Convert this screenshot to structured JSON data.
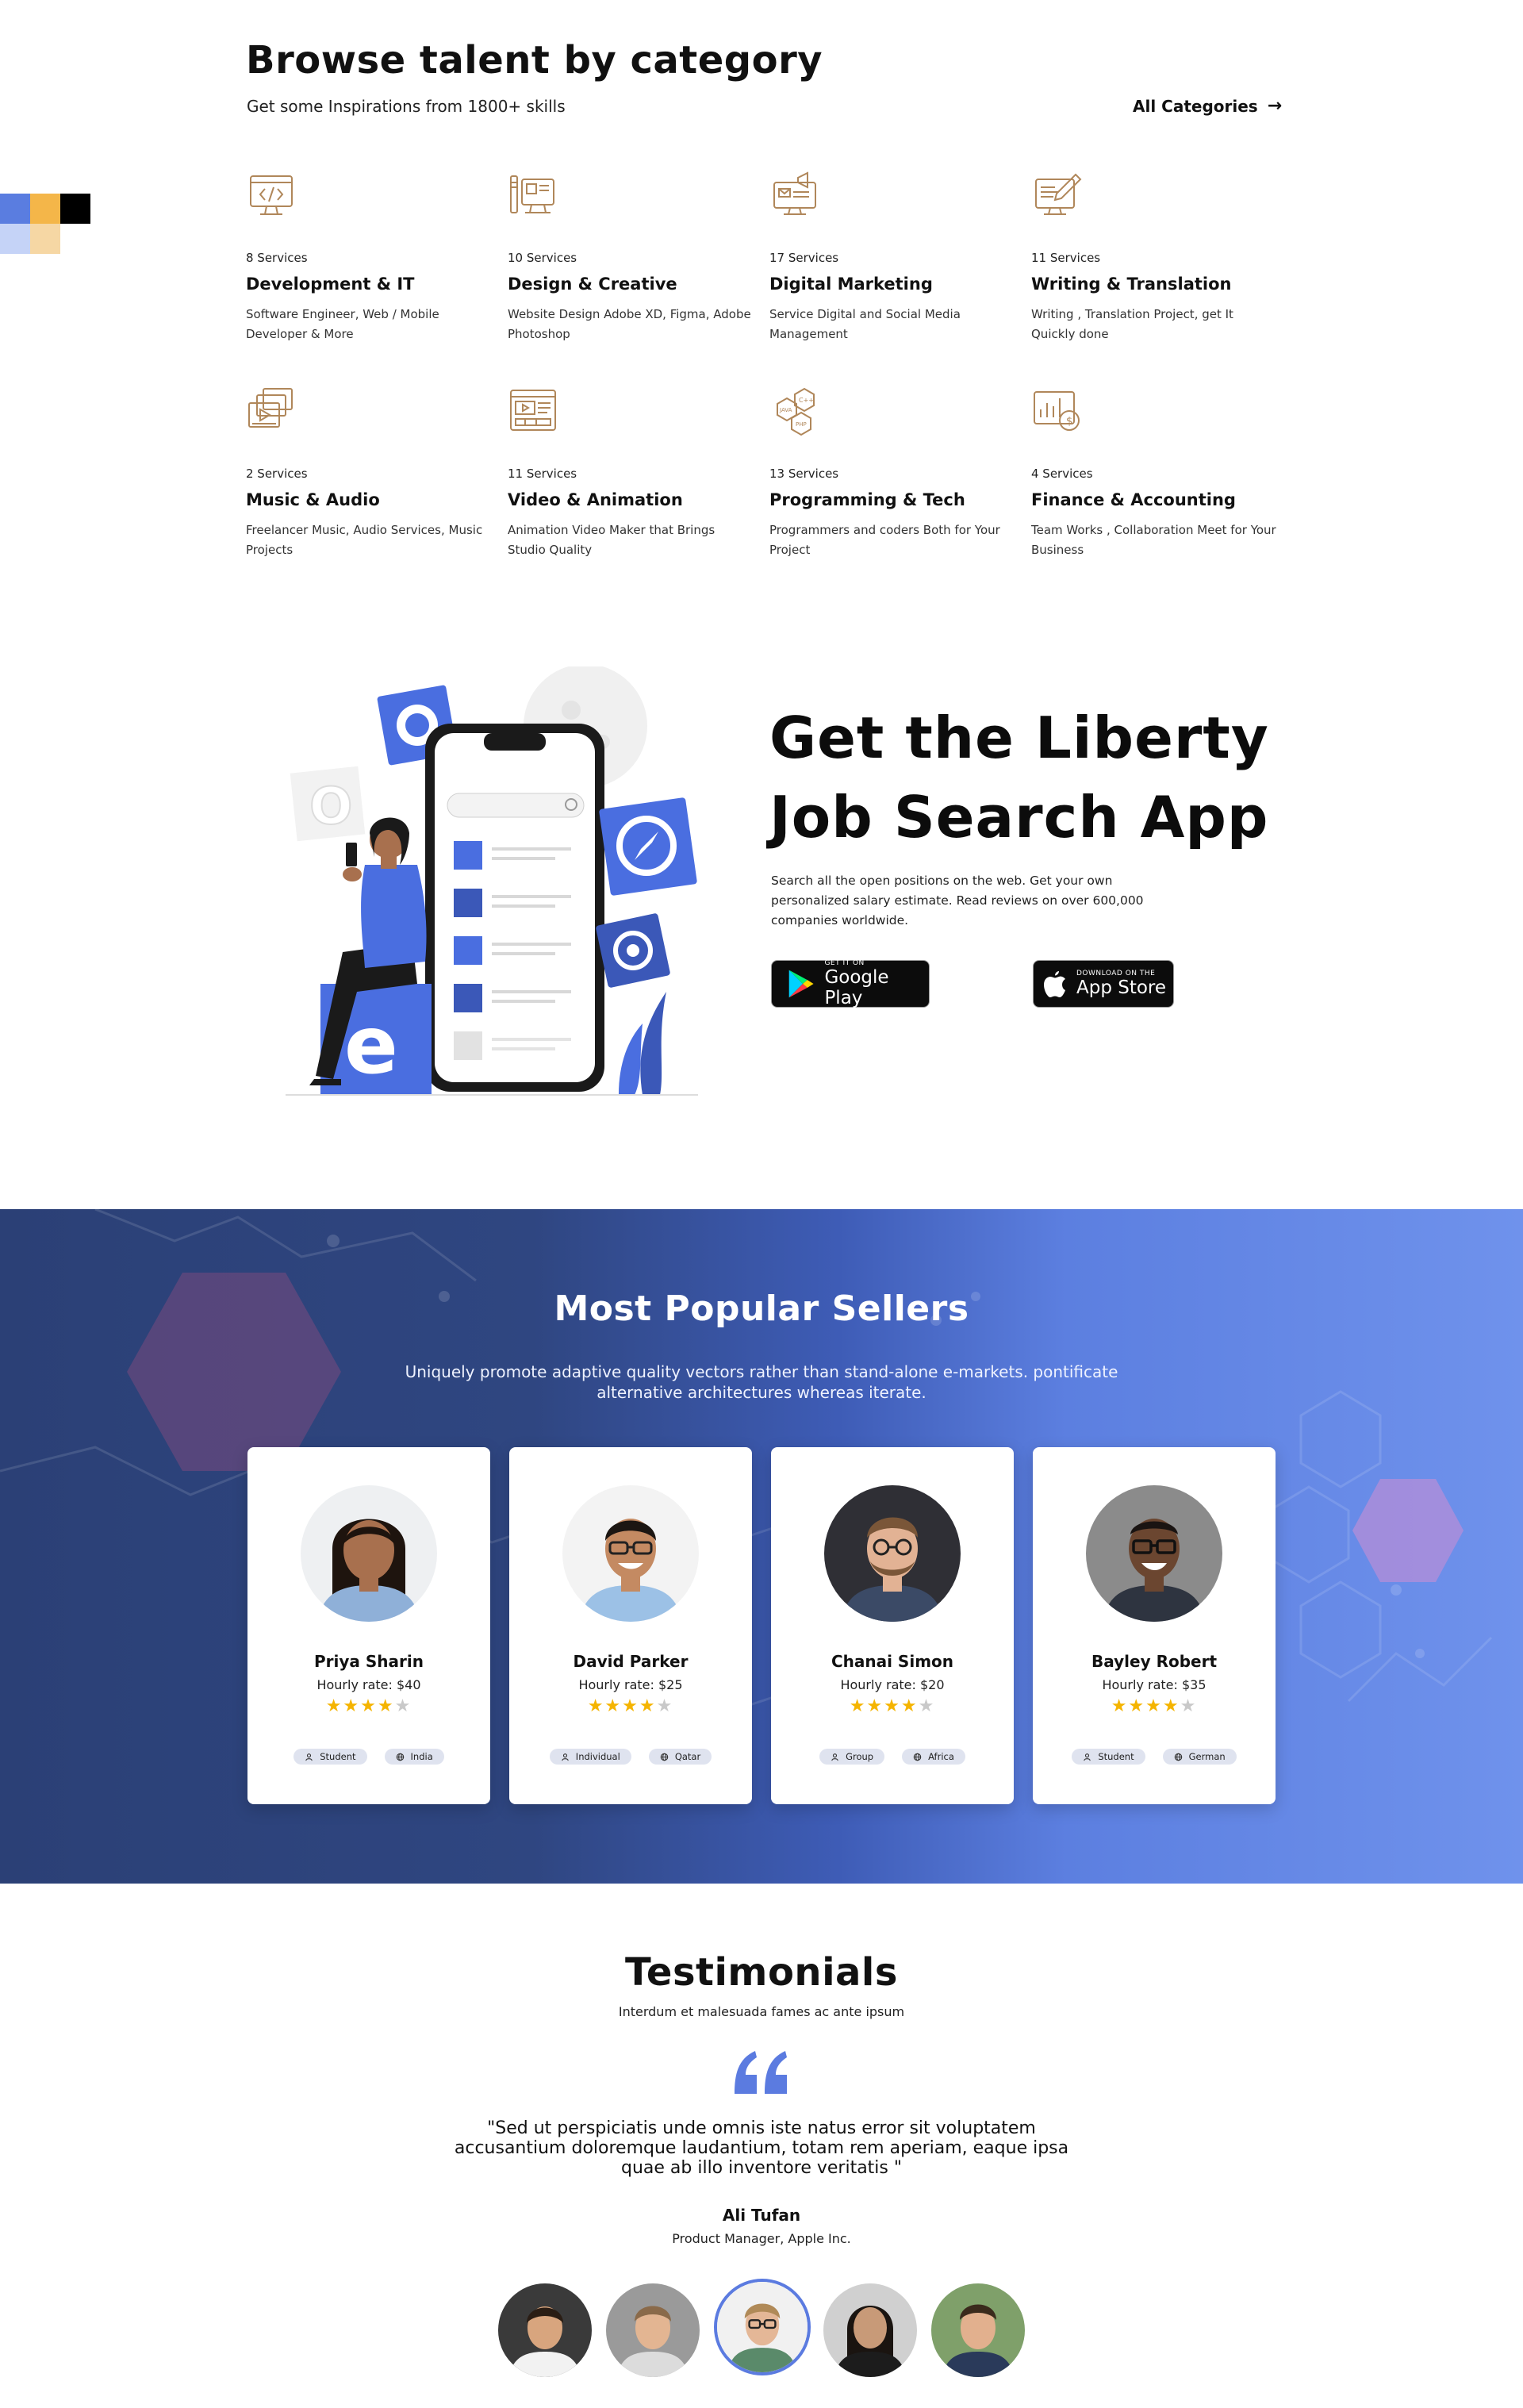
{
  "categories": {
    "title": "Browse talent by category",
    "subtitle": "Get some Inspirations from 1800+ skills",
    "all_link": "All Categories",
    "items": [
      {
        "count": "8 Services",
        "name": "Development & IT",
        "desc": "Software Engineer, Web / Mobile Developer & More",
        "icon": "code-monitor-icon"
      },
      {
        "count": "10 Services",
        "name": "Design & Creative",
        "desc": "Website Design Adobe XD, Figma, Adobe Photoshop",
        "icon": "design-tools-icon"
      },
      {
        "count": "17 Services",
        "name": "Digital Marketing",
        "desc": "Service Digital and Social Media Management",
        "icon": "megaphone-monitor-icon"
      },
      {
        "count": "11 Services",
        "name": "Writing & Translation",
        "desc": "Writing , Translation Project, get It Quickly done",
        "icon": "writing-document-icon"
      },
      {
        "count": "2 Services",
        "name": "Music & Audio",
        "desc": "Freelancer Music, Audio Services, Music Projects",
        "icon": "media-player-icon"
      },
      {
        "count": "11 Services",
        "name": "Video & Animation",
        "desc": "Animation Video Maker that Brings Studio Quality",
        "icon": "video-editor-icon"
      },
      {
        "count": "13 Services",
        "name": "Programming & Tech",
        "desc": "Programmers and coders Both for Your Project",
        "icon": "programming-hexagons-icon"
      },
      {
        "count": "4 Services",
        "name": "Finance & Accounting",
        "desc": "Team Works , Collaboration Meet for Your Business",
        "icon": "finance-chart-icon"
      }
    ]
  },
  "app": {
    "title_line1": "Get the Liberty",
    "title_line2": "Job Search App",
    "desc": "Search all the open positions on the web. Get your own personalized salary estimate. Read reviews on over 600,000 companies worldwide.",
    "google_small": "GET IT ON",
    "google_big": "Google Play",
    "apple_small": "DOWNLOAD ON THE",
    "apple_big": "App Store"
  },
  "sellers": {
    "title": "Most Popular Sellers",
    "subtitle": "Uniquely promote adaptive quality vectors rather than stand-alone e-markets. pontificate alternative architectures whereas iterate.",
    "items": [
      {
        "name": "Priya Sharin",
        "rate": "Hourly rate: $40",
        "rating": 4,
        "tag1": "Student",
        "tag2": "India",
        "skin": "#a8704e",
        "hair": "#1e140e",
        "shirt": "#8fb0d8",
        "bg": "#eef0f2"
      },
      {
        "name": "David Parker",
        "rate": "Hourly rate: $25",
        "rating": 4,
        "tag1": "Individual",
        "tag2": "Qatar",
        "skin": "#c48a62",
        "hair": "#1c1612",
        "shirt": "#9cc1e6",
        "bg": "#f3f3f3"
      },
      {
        "name": "Chanai Simon",
        "rate": "Hourly rate: $20",
        "rating": 4,
        "tag1": "Group",
        "tag2": "Africa",
        "skin": "#e2b294",
        "hair": "#7a5638",
        "shirt": "#3b4a66",
        "bg": "#2f2f35"
      },
      {
        "name": "Bayley Robert",
        "rate": "Hourly rate: $35",
        "rating": 4,
        "tag1": "Student",
        "tag2": "German",
        "skin": "#6b4630",
        "hair": "#1a1412",
        "shirt": "#2e3440",
        "bg": "#8b8b8b"
      }
    ]
  },
  "testimonials": {
    "title": "Testimonials",
    "subtitle": "Interdum et malesuada fames ac ante ipsum",
    "quote": "\"Sed ut perspiciatis unde omnis iste natus error sit voluptatem accusantium doloremque laudantium, totam rem aperiam, eaque ipsa quae ab illo inventore veritatis \"",
    "author": "Ali Tufan",
    "role": "Product Manager, Apple Inc.",
    "avatars": [
      {
        "skin": "#d8a57e",
        "hair": "#2a1d14",
        "shirt": "#f2f2f2",
        "bg": "#3a3a3a"
      },
      {
        "skin": "#e3b592",
        "hair": "#8a6a4a",
        "shirt": "#dcdcdc",
        "bg": "#9a9a9a"
      },
      {
        "skin": "#e4b797",
        "hair": "#b08a58",
        "shirt": "#5a8a6a",
        "bg": "#f1f1f1",
        "active": true
      },
      {
        "skin": "#c89a78",
        "hair": "#1a1410",
        "shirt": "#1c1c1c",
        "bg": "#d0d0d0"
      },
      {
        "skin": "#e2b08e",
        "hair": "#3a2a1c",
        "shirt": "#2a3a5a",
        "bg": "#7fa06a"
      }
    ]
  },
  "colors": {
    "accent": "#5b7be0",
    "star": "#f5b400",
    "icon_stroke": "#b0875a"
  }
}
